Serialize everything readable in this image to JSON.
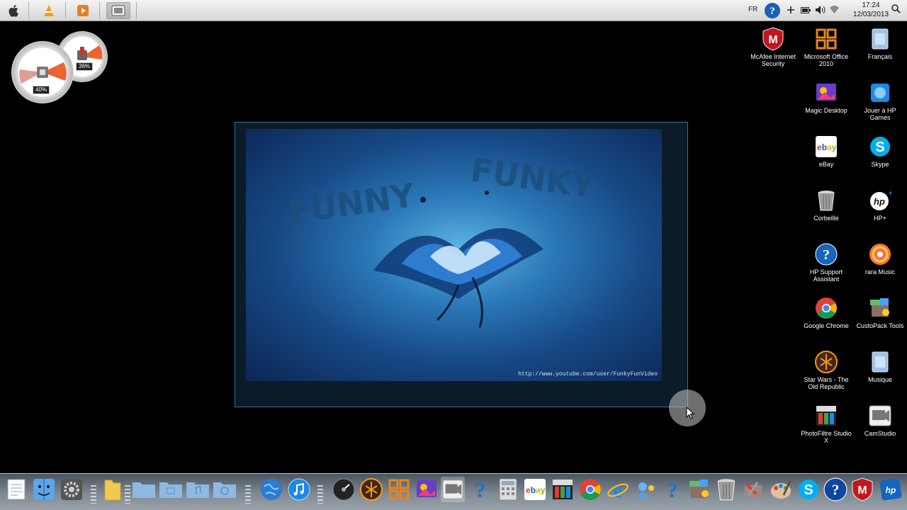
{
  "menubar": {
    "taskbar_items": [
      {
        "name": "vlc-task",
        "active": false
      },
      {
        "name": "media-player-task",
        "active": false
      },
      {
        "name": "camstudio-task",
        "active": true
      }
    ],
    "language": "FR",
    "clock_time": "17:24",
    "clock_date": "12/03/2013"
  },
  "gauges": {
    "cpu_percent": "40%",
    "memory_percent": "36%"
  },
  "preview": {
    "wallpaper_url": "http://www.youtube.com/user/FunkyFunVideo"
  },
  "desktop_icons": [
    {
      "label": "McAfee Internet Security",
      "icon": "mcafee-icon"
    },
    {
      "label": "Microsoft Office 2010",
      "icon": "office-icon"
    },
    {
      "label": "Français",
      "icon": "folder-doc-icon"
    },
    {
      "label": "Magic Desktop",
      "icon": "magic-desktop-icon"
    },
    {
      "label": "Jouer à HP Games",
      "icon": "hp-games-icon"
    },
    {
      "label": "eBay",
      "icon": "ebay-icon"
    },
    {
      "label": "Skype",
      "icon": "skype-icon"
    },
    {
      "label": "Corbeille",
      "icon": "trash-icon"
    },
    {
      "label": "HP+",
      "icon": "hp-plus-icon"
    },
    {
      "label": "HP Support Assistant",
      "icon": "help-icon"
    },
    {
      "label": "rara Music",
      "icon": "rara-icon"
    },
    {
      "label": "Google Chrome",
      "icon": "chrome-icon"
    },
    {
      "label": "CustoPack Tools",
      "icon": "custopack-icon"
    },
    {
      "label": "Star Wars - The Old Republic",
      "icon": "star-wars-icon"
    },
    {
      "label": "Musique",
      "icon": "folder-music-icon"
    },
    {
      "label": "PhotoFiltre Studio X",
      "icon": "photofiltre-icon"
    },
    {
      "label": "CamStudio",
      "icon": "camstudio-icon"
    }
  ],
  "dock_items": [
    "textedit-icon",
    "finder-icon",
    "settings-icon",
    "separator",
    "folder-icon",
    "separator",
    "folder-docs-icon",
    "folder-pictures-icon",
    "folder-music-icon",
    "folder-downloads-icon",
    "separator",
    "globe-icon",
    "itunes-icon",
    "separator",
    "dashboard-icon",
    "star-wars-icon",
    "office-icon",
    "magic-desktop-icon",
    "camstudio-icon",
    "help-icon",
    "calculator-icon",
    "ebay-icon",
    "photofiltre-icon",
    "chrome-icon",
    "ie-icon",
    "hp-games-icon",
    "help-icon",
    "custopack-icon",
    "trash-icon",
    "tools-icon",
    "paint-icon",
    "skype-icon",
    "hp-support-icon",
    "mcafee-icon",
    "hp-icon"
  ]
}
